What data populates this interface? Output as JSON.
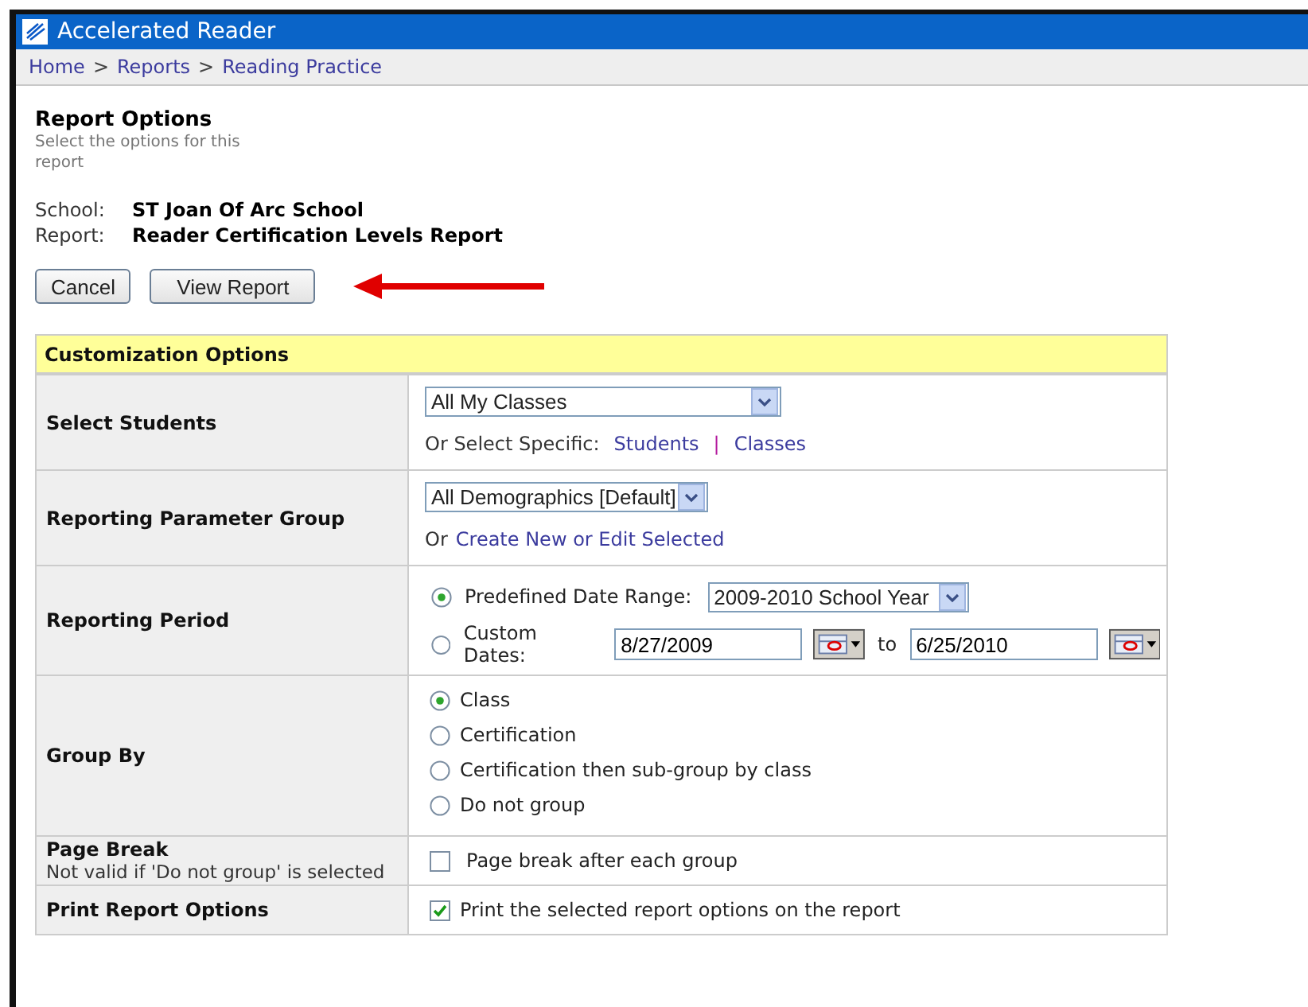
{
  "window": {
    "title": "Accelerated Reader"
  },
  "breadcrumb": [
    {
      "label": "Home",
      "kind": "link"
    },
    {
      "label": ">",
      "kind": "separator"
    },
    {
      "label": "Reports",
      "kind": "link"
    },
    {
      "label": ">",
      "kind": "separator"
    },
    {
      "label": "Reading Practice",
      "kind": "link"
    }
  ],
  "page": {
    "heading": "Report Options",
    "subtitle": "Select the options for this report"
  },
  "info": [
    {
      "label": "School:",
      "value": "ST Joan Of Arc School"
    },
    {
      "label": "Report:",
      "value": "Reader Certification Levels Report"
    }
  ],
  "buttons": [
    "Cancel",
    "View Report"
  ],
  "options_table": {
    "header": "Customization Options",
    "rows": [
      {
        "kind": "dropdown_links",
        "label": "Select Students",
        "dropdown": "All My Classes",
        "prefix": "Or Select Specific:",
        "links": [
          "Students",
          "Classes"
        ],
        "separator": "|"
      },
      {
        "kind": "dropdown_link",
        "label": "Reporting Parameter Group",
        "dropdown": "All Demographics [Default]",
        "prefix": "Or",
        "link": "Create New or Edit Selected"
      },
      {
        "kind": "period",
        "label": "Reporting Period",
        "options": [
          {
            "kind": "range",
            "label": "Predefined Date Range:",
            "selected": true,
            "dropdown": "2009-2010 School Year"
          },
          {
            "kind": "dates",
            "label": "Custom Dates:",
            "selected": false,
            "from": "8/27/2009",
            "to_label": "to",
            "to": "6/25/2010"
          }
        ]
      },
      {
        "kind": "radios",
        "label": "Group By",
        "options": [
          {
            "label": "Class",
            "selected": true
          },
          {
            "label": "Certification",
            "selected": false
          },
          {
            "label": "Certification then sub-group by class",
            "selected": false
          },
          {
            "label": "Do not group",
            "selected": false
          }
        ]
      },
      {
        "kind": "checkbox",
        "label": "Page Break",
        "note": "Not valid if 'Do not group' is selected",
        "option": "Page break after each group",
        "checked": false
      },
      {
        "kind": "checkbox",
        "label": "Print Report Options",
        "option": "Print the selected report options on the report",
        "checked": true
      }
    ]
  }
}
